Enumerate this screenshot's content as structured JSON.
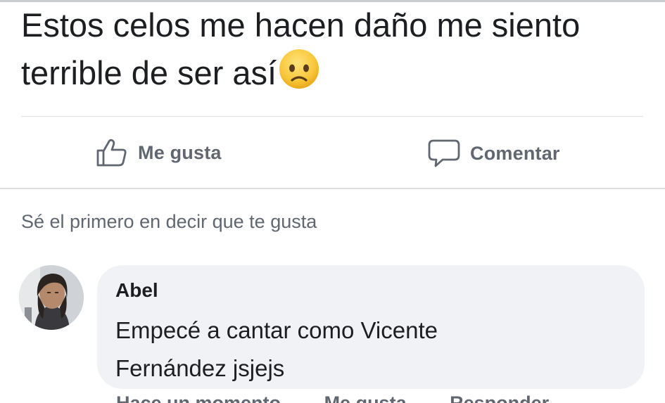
{
  "post": {
    "text": "Estos celos me hacen daño me siento terrible de ser así"
  },
  "actions": {
    "like_label": "Me gusta",
    "comment_label": "Comentar"
  },
  "reactions": {
    "first_like_text": "Sé el primero en decir que te gusta"
  },
  "comment": {
    "author": "Abel",
    "body": "Empecé a cantar como Vicente Fernández jsjejs",
    "actions": [
      "Hace un momento",
      "Me gusta",
      "Responder"
    ]
  },
  "colors": {
    "text": "#1c1e21",
    "secondary": "#606770",
    "bubble": "#f0f2f5",
    "divider": "#dddfe2"
  },
  "icons": [
    "thumbs-up-icon",
    "comment-icon",
    "sad-face-emoji"
  ]
}
